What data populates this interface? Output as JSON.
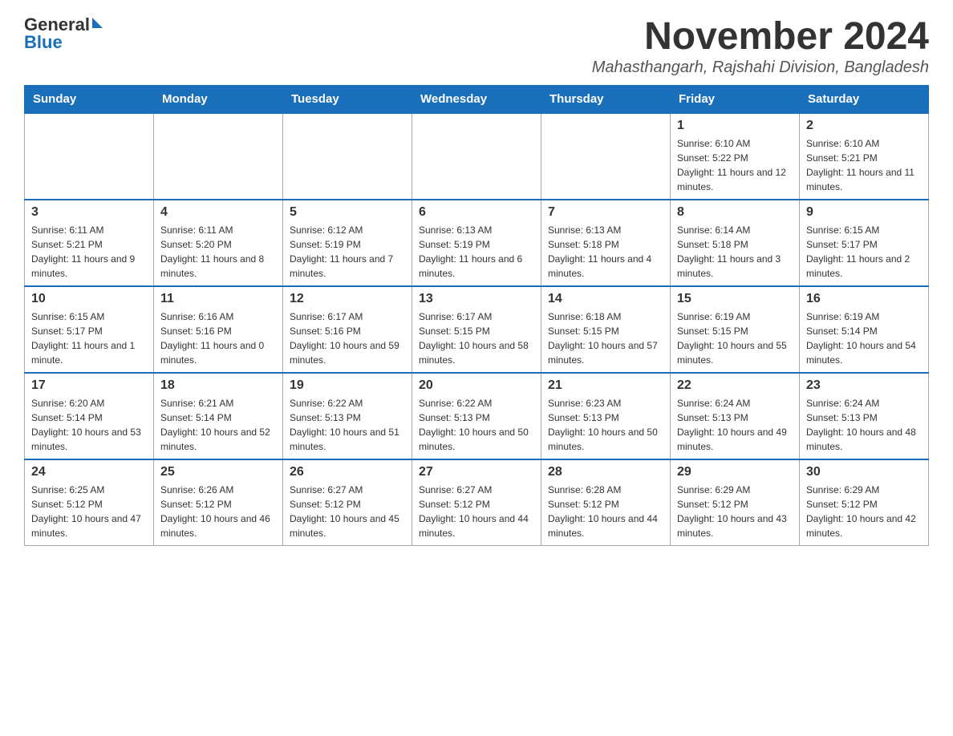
{
  "header": {
    "logo_general": "General",
    "logo_blue": "Blue",
    "month_year": "November 2024",
    "location": "Mahasthangarh, Rajshahi Division, Bangladesh"
  },
  "days_of_week": [
    "Sunday",
    "Monday",
    "Tuesday",
    "Wednesday",
    "Thursday",
    "Friday",
    "Saturday"
  ],
  "weeks": [
    {
      "cells": [
        {
          "day": "",
          "info": ""
        },
        {
          "day": "",
          "info": ""
        },
        {
          "day": "",
          "info": ""
        },
        {
          "day": "",
          "info": ""
        },
        {
          "day": "",
          "info": ""
        },
        {
          "day": "1",
          "info": "Sunrise: 6:10 AM\nSunset: 5:22 PM\nDaylight: 11 hours and 12 minutes."
        },
        {
          "day": "2",
          "info": "Sunrise: 6:10 AM\nSunset: 5:21 PM\nDaylight: 11 hours and 11 minutes."
        }
      ]
    },
    {
      "cells": [
        {
          "day": "3",
          "info": "Sunrise: 6:11 AM\nSunset: 5:21 PM\nDaylight: 11 hours and 9 minutes."
        },
        {
          "day": "4",
          "info": "Sunrise: 6:11 AM\nSunset: 5:20 PM\nDaylight: 11 hours and 8 minutes."
        },
        {
          "day": "5",
          "info": "Sunrise: 6:12 AM\nSunset: 5:19 PM\nDaylight: 11 hours and 7 minutes."
        },
        {
          "day": "6",
          "info": "Sunrise: 6:13 AM\nSunset: 5:19 PM\nDaylight: 11 hours and 6 minutes."
        },
        {
          "day": "7",
          "info": "Sunrise: 6:13 AM\nSunset: 5:18 PM\nDaylight: 11 hours and 4 minutes."
        },
        {
          "day": "8",
          "info": "Sunrise: 6:14 AM\nSunset: 5:18 PM\nDaylight: 11 hours and 3 minutes."
        },
        {
          "day": "9",
          "info": "Sunrise: 6:15 AM\nSunset: 5:17 PM\nDaylight: 11 hours and 2 minutes."
        }
      ]
    },
    {
      "cells": [
        {
          "day": "10",
          "info": "Sunrise: 6:15 AM\nSunset: 5:17 PM\nDaylight: 11 hours and 1 minute."
        },
        {
          "day": "11",
          "info": "Sunrise: 6:16 AM\nSunset: 5:16 PM\nDaylight: 11 hours and 0 minutes."
        },
        {
          "day": "12",
          "info": "Sunrise: 6:17 AM\nSunset: 5:16 PM\nDaylight: 10 hours and 59 minutes."
        },
        {
          "day": "13",
          "info": "Sunrise: 6:17 AM\nSunset: 5:15 PM\nDaylight: 10 hours and 58 minutes."
        },
        {
          "day": "14",
          "info": "Sunrise: 6:18 AM\nSunset: 5:15 PM\nDaylight: 10 hours and 57 minutes."
        },
        {
          "day": "15",
          "info": "Sunrise: 6:19 AM\nSunset: 5:15 PM\nDaylight: 10 hours and 55 minutes."
        },
        {
          "day": "16",
          "info": "Sunrise: 6:19 AM\nSunset: 5:14 PM\nDaylight: 10 hours and 54 minutes."
        }
      ]
    },
    {
      "cells": [
        {
          "day": "17",
          "info": "Sunrise: 6:20 AM\nSunset: 5:14 PM\nDaylight: 10 hours and 53 minutes."
        },
        {
          "day": "18",
          "info": "Sunrise: 6:21 AM\nSunset: 5:14 PM\nDaylight: 10 hours and 52 minutes."
        },
        {
          "day": "19",
          "info": "Sunrise: 6:22 AM\nSunset: 5:13 PM\nDaylight: 10 hours and 51 minutes."
        },
        {
          "day": "20",
          "info": "Sunrise: 6:22 AM\nSunset: 5:13 PM\nDaylight: 10 hours and 50 minutes."
        },
        {
          "day": "21",
          "info": "Sunrise: 6:23 AM\nSunset: 5:13 PM\nDaylight: 10 hours and 50 minutes."
        },
        {
          "day": "22",
          "info": "Sunrise: 6:24 AM\nSunset: 5:13 PM\nDaylight: 10 hours and 49 minutes."
        },
        {
          "day": "23",
          "info": "Sunrise: 6:24 AM\nSunset: 5:13 PM\nDaylight: 10 hours and 48 minutes."
        }
      ]
    },
    {
      "cells": [
        {
          "day": "24",
          "info": "Sunrise: 6:25 AM\nSunset: 5:12 PM\nDaylight: 10 hours and 47 minutes."
        },
        {
          "day": "25",
          "info": "Sunrise: 6:26 AM\nSunset: 5:12 PM\nDaylight: 10 hours and 46 minutes."
        },
        {
          "day": "26",
          "info": "Sunrise: 6:27 AM\nSunset: 5:12 PM\nDaylight: 10 hours and 45 minutes."
        },
        {
          "day": "27",
          "info": "Sunrise: 6:27 AM\nSunset: 5:12 PM\nDaylight: 10 hours and 44 minutes."
        },
        {
          "day": "28",
          "info": "Sunrise: 6:28 AM\nSunset: 5:12 PM\nDaylight: 10 hours and 44 minutes."
        },
        {
          "day": "29",
          "info": "Sunrise: 6:29 AM\nSunset: 5:12 PM\nDaylight: 10 hours and 43 minutes."
        },
        {
          "day": "30",
          "info": "Sunrise: 6:29 AM\nSunset: 5:12 PM\nDaylight: 10 hours and 42 minutes."
        }
      ]
    }
  ]
}
